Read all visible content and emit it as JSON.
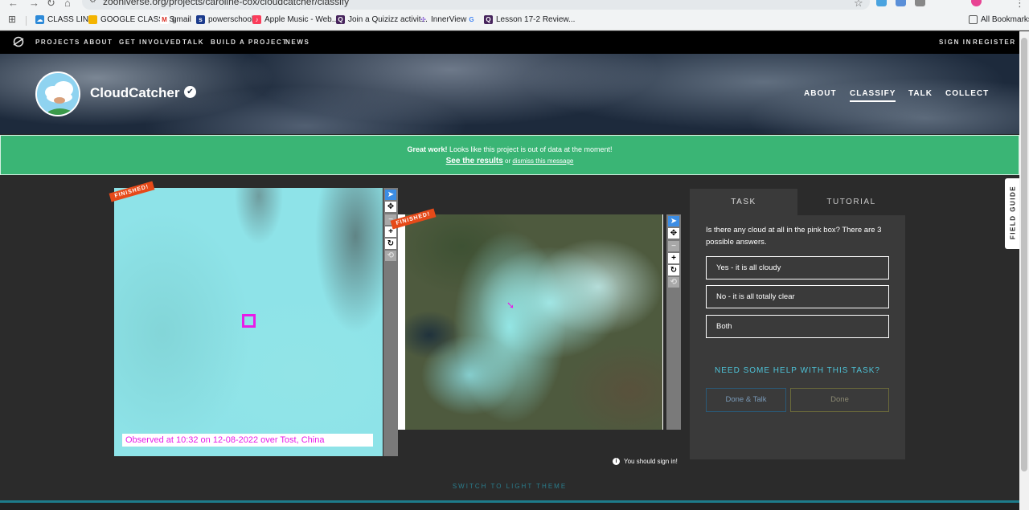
{
  "browser": {
    "url": "zooniverse.org/projects/caroline-cox/cloudcatcher/classify",
    "bookmarks": [
      "CLASS LINK",
      "GOOGLE CLASSES",
      "gmail",
      "powerschool",
      "Apple Music - Web...",
      "Join a Quizizz activit...",
      "InnerView",
      "Lesson 17-2 Review..."
    ],
    "all_bookmarks": "All Bookmarks"
  },
  "zooniverse_nav": {
    "items": [
      "PROJECTS",
      "ABOUT",
      "GET INVOLVED",
      "TALK",
      "BUILD A PROJECT",
      "NEWS"
    ],
    "sign_in": "SIGN IN",
    "register": "REGISTER"
  },
  "project": {
    "title": "CloudCatcher",
    "nav": [
      "ABOUT",
      "CLASSIFY",
      "TALK",
      "COLLECT"
    ],
    "active_nav": "CLASSIFY"
  },
  "banner": {
    "strong": "Great work!",
    "message": " Looks like this project is out of data at the moment!",
    "results_link": "See the results",
    "or": " or ",
    "dismiss_link": "dismiss this message"
  },
  "subject": {
    "finished_label": "FINISHED!",
    "caption": "Observed at 10:32 on 12-08-2022 over Tost, China"
  },
  "task": {
    "tab_task": "TASK",
    "tab_tutorial": "TUTORIAL",
    "question": "Is there any cloud at all in the pink box? There are 3 possible answers.",
    "answers": [
      "Yes - it is all cloudy",
      "No - it is all totally clear",
      "Both"
    ],
    "help": "NEED SOME HELP WITH THIS TASK?",
    "done_talk": "Done & Talk",
    "done": "Done"
  },
  "signin_notice": "You should sign in!",
  "theme_switch": "SWITCH TO LIGHT THEME",
  "field_guide": "FIELD GUIDE",
  "colors": {
    "banner": "#3ab575",
    "accent": "#4ec3d8",
    "finished": "#e64a19",
    "marker": "#e81ce8"
  }
}
